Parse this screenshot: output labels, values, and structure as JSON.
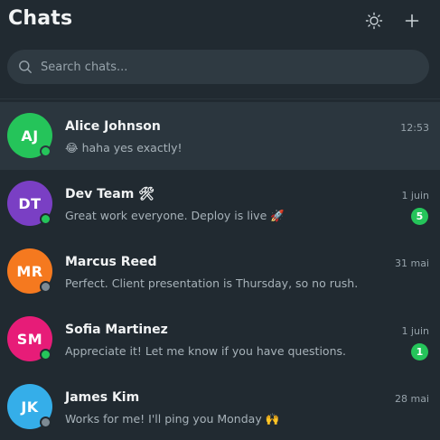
{
  "header": {
    "title": "Chats",
    "theme_icon": "sun-icon",
    "new_chat_icon": "plus-icon"
  },
  "search": {
    "placeholder": "Search chats...",
    "value": ""
  },
  "colors": {
    "background": "#212a31",
    "active_row": "#2b363e",
    "online": "#25c45a",
    "offline": "#7d8a93",
    "unread_badge": "#25c45a"
  },
  "chats": [
    {
      "initials": "AJ",
      "avatar_color": "#25c45a",
      "name": "Alice Johnson",
      "time": "12:53",
      "preview": "😂 haha yes exactly!",
      "online": true,
      "unread": "",
      "active": true
    },
    {
      "initials": "DT",
      "avatar_color": "#7a3fc4",
      "name": "Dev Team 🛠",
      "time": "1 juin",
      "preview": "Great work everyone. Deploy is live 🚀",
      "online": true,
      "unread": "5",
      "active": false
    },
    {
      "initials": "MR",
      "avatar_color": "#f5791f",
      "name": "Marcus Reed",
      "time": "31 mai",
      "preview": "Perfect. Client presentation is Thursday, so no rush.",
      "online": false,
      "unread": "",
      "active": false
    },
    {
      "initials": "SM",
      "avatar_color": "#e71c78",
      "name": "Sofia Martinez",
      "time": "1 juin",
      "preview": "Appreciate it! Let me know if you have questions.",
      "online": true,
      "unread": "1",
      "active": false
    },
    {
      "initials": "JK",
      "avatar_color": "#35aee9",
      "name": "James Kim",
      "time": "28 mai",
      "preview": "Works for me! I'll ping you Monday 🙌",
      "online": false,
      "unread": "",
      "active": false
    }
  ]
}
